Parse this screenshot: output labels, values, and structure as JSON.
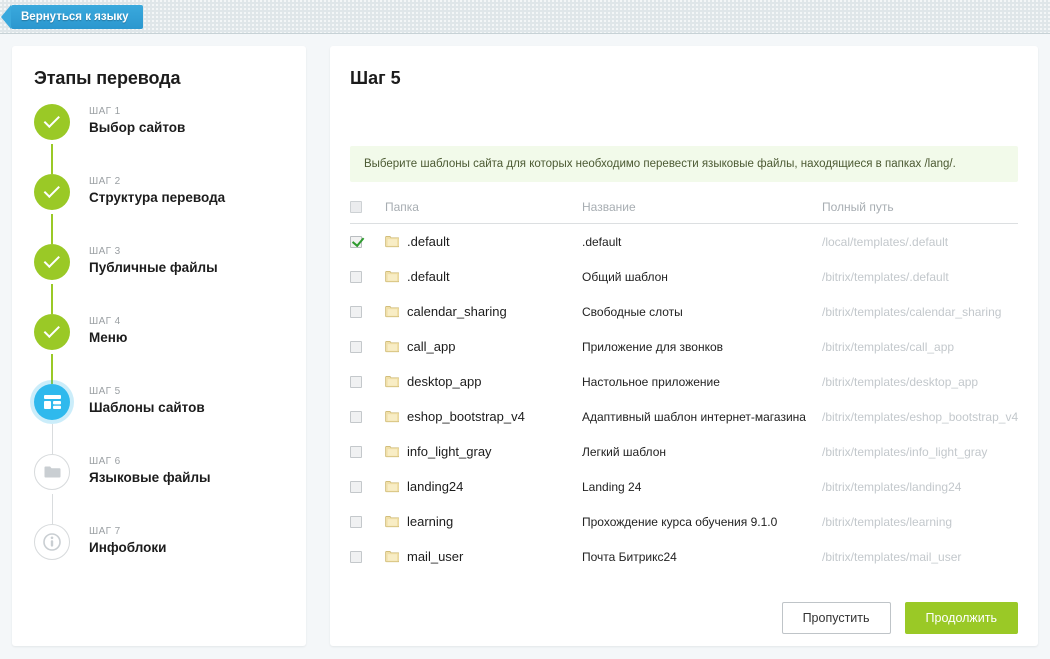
{
  "topbar": {
    "back_button": "Вернуться к языку",
    "back_icon": "chevron-left-icon"
  },
  "sidebar": {
    "title": "Этапы перевода",
    "items": [
      {
        "num": "ШАГ 1",
        "label": "Выбор сайтов",
        "state": "done",
        "icon": "check-icon"
      },
      {
        "num": "ШАГ 2",
        "label": "Структура перевода",
        "state": "done",
        "icon": "check-icon"
      },
      {
        "num": "ШАГ 3",
        "label": "Публичные файлы",
        "state": "done",
        "icon": "check-icon"
      },
      {
        "num": "ШАГ 4",
        "label": "Меню",
        "state": "done",
        "icon": "check-icon"
      },
      {
        "num": "ШАГ 5",
        "label": "Шаблоны сайтов",
        "state": "active",
        "icon": "template-icon"
      },
      {
        "num": "ШАГ 6",
        "label": "Языковые файлы",
        "state": "todo",
        "icon": "folder-icon"
      },
      {
        "num": "ШАГ 7",
        "label": "Инфоблоки",
        "state": "todo",
        "icon": "info-icon"
      }
    ]
  },
  "main": {
    "heading": "Шаг 5",
    "notice": "Выберите шаблоны сайта для которых необходимо перевести языковые файлы, находящиеся в папках /lang/.",
    "table": {
      "columns": [
        "Папка",
        "Название",
        "Полный путь"
      ],
      "rows": [
        {
          "checked": true,
          "folder": ".default",
          "name": ".default",
          "path": "/local/templates/.default"
        },
        {
          "checked": false,
          "folder": ".default",
          "name": "Общий шаблон",
          "path": "/bitrix/templates/.default"
        },
        {
          "checked": false,
          "folder": "calendar_sharing",
          "name": "Свободные слоты",
          "path": "/bitrix/templates/calendar_sharing"
        },
        {
          "checked": false,
          "folder": "call_app",
          "name": "Приложение для звонков",
          "path": "/bitrix/templates/call_app"
        },
        {
          "checked": false,
          "folder": "desktop_app",
          "name": "Настольное приложение",
          "path": "/bitrix/templates/desktop_app"
        },
        {
          "checked": false,
          "folder": "eshop_bootstrap_v4",
          "name": "Адаптивный шаблон интернет-магазина",
          "path": "/bitrix/templates/eshop_bootstrap_v4"
        },
        {
          "checked": false,
          "folder": "info_light_gray",
          "name": "Легкий шаблон",
          "path": "/bitrix/templates/info_light_gray"
        },
        {
          "checked": false,
          "folder": "landing24",
          "name": "Landing 24",
          "path": "/bitrix/templates/landing24"
        },
        {
          "checked": false,
          "folder": "learning",
          "name": "Прохождение курса обучения 9.1.0",
          "path": "/bitrix/templates/learning"
        },
        {
          "checked": false,
          "folder": "mail_user",
          "name": "Почта Битрикс24",
          "path": "/bitrix/templates/mail_user"
        }
      ]
    },
    "buttons": {
      "skip": "Пропустить",
      "continue": "Продолжить"
    }
  },
  "colors": {
    "accent_green": "#9ac926",
    "accent_blue": "#2fb9ed",
    "back_button_blue": "#3aa9dd",
    "notice_bg": "#f2faea",
    "page_bg": "#f4f7f9",
    "path_text": "#c3c8cc"
  }
}
